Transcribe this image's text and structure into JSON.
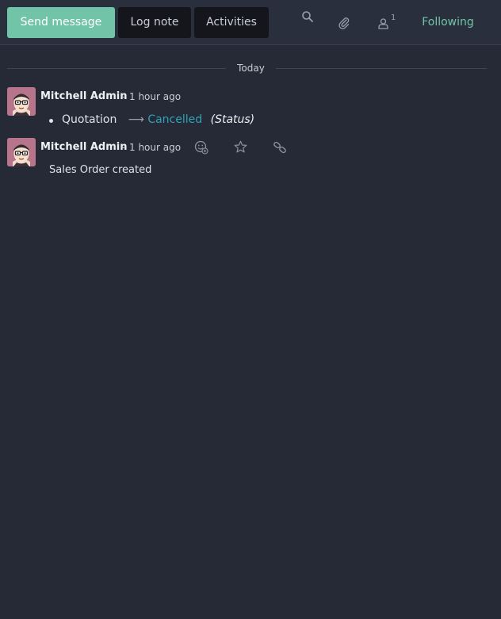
{
  "toolbar": {
    "send_message": "Send message",
    "log_note": "Log note",
    "activities": "Activities",
    "follower_count": "1",
    "following": "Following"
  },
  "icons": {
    "search": "search-icon",
    "attachment": "paperclip-icon",
    "followers": "user-icon",
    "add_reaction": "smiley-add-icon",
    "star": "star-icon",
    "link": "link-icon"
  },
  "separator": {
    "label": "Today"
  },
  "messages": [
    {
      "author": "Mitchell Admin",
      "dash": "-",
      "time": "1 hour ago",
      "tracking": {
        "old_value": "Quotation",
        "new_value": "Cancelled",
        "field": "(Status)"
      }
    },
    {
      "author": "Mitchell Admin",
      "dash": "-",
      "time": "1 hour ago",
      "body": "Sales Order created"
    }
  ],
  "colors": {
    "background": "#262a36",
    "accent": "#71c4a8",
    "new_value": "#2fa3b5"
  }
}
